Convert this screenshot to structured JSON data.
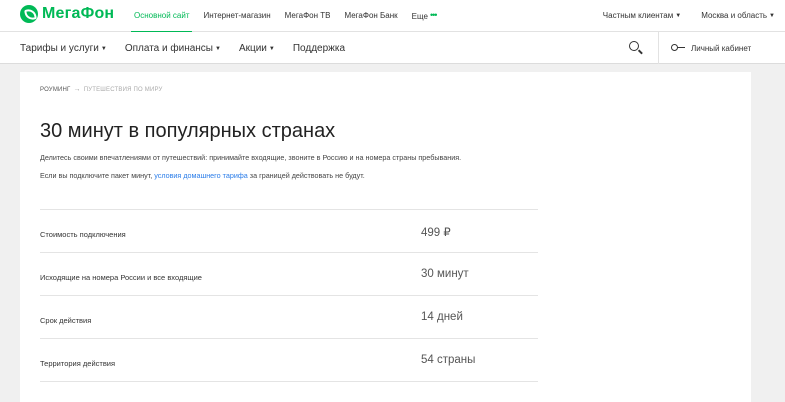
{
  "brand": {
    "name": "МегаФон",
    "color": "#00b956"
  },
  "top_links": [
    {
      "label": "Основной сайт",
      "active": true
    },
    {
      "label": "Интернет-магазин"
    },
    {
      "label": "МегаФон ТВ"
    },
    {
      "label": "МегаФон Банк"
    },
    {
      "label": "Еще"
    }
  ],
  "top_right": {
    "segment": "Частным клиентам",
    "region": "Москва и область"
  },
  "main_nav": [
    {
      "label": "Тарифы и услуги"
    },
    {
      "label": "Оплата и финансы"
    },
    {
      "label": "Акции"
    },
    {
      "label": "Поддержка"
    }
  ],
  "cabinet_label": "Личный кабинет",
  "icons": {
    "search": "search-icon",
    "cabinet": "key-icon",
    "more": "dots-icon",
    "dropdown": "caret-down-icon"
  },
  "breadcrumb": {
    "root": "Роуминг",
    "current": "Путешествия по миру"
  },
  "page": {
    "title": "30 минут в популярных странах",
    "lead": "Делитесь своими впечатлениями от путешествий: принимайте входящие, звоните в Россию и на номера страны пребывания.",
    "lead2_before": "Если вы подключите пакет минут,",
    "lead2_link": "условия домашнего тарифа",
    "lead2_after": "за границей действовать не будут."
  },
  "rows": [
    {
      "label": "Стоимость подключения",
      "value": "499 ₽"
    },
    {
      "label": "Исходящие на номера России и все входящие",
      "value": "30 минут"
    },
    {
      "label": "Срок действия",
      "value": "14 дней"
    },
    {
      "label": "Территория действия",
      "value": "54 страны"
    }
  ]
}
